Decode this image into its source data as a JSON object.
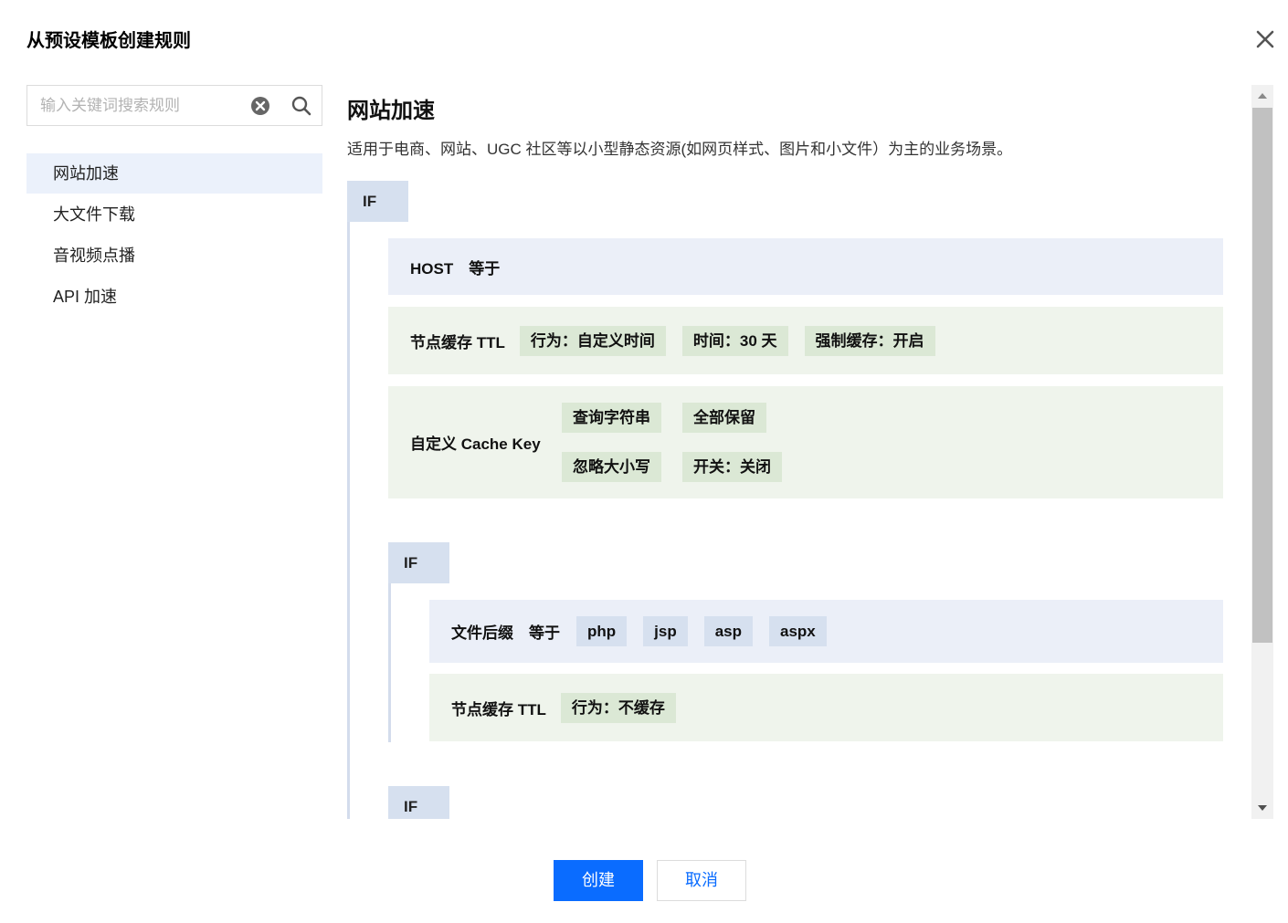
{
  "dialog": {
    "title": "从预设模板创建规则",
    "close_icon": "close-icon"
  },
  "search": {
    "placeholder": "输入关键词搜索规则",
    "value": ""
  },
  "sidebar": {
    "items": [
      {
        "label": "网站加速",
        "active": true
      },
      {
        "label": "大文件下载",
        "active": false
      },
      {
        "label": "音视频点播",
        "active": false
      },
      {
        "label": "API 加速",
        "active": false
      }
    ]
  },
  "content": {
    "title": "网站加速",
    "description": "适用于电商、网站、UGC 社区等以小型静态资源(如网页样式、图片和小文件）为主的业务场景。",
    "blocks": [
      {
        "if_label": "IF",
        "condition": {
          "label": "HOST　等于"
        },
        "actions": [
          {
            "label": "节点缓存 TTL",
            "chips": [
              "行为：自定义时间",
              "时间：30 天",
              "强制缓存：开启"
            ]
          },
          {
            "label": "自定义 Cache Key",
            "chips": [
              "查询字符串",
              "全部保留",
              "忽略大小写",
              "开关：关闭"
            ]
          }
        ]
      },
      {
        "if_label": "IF",
        "condition": {
          "label": "文件后缀　等于",
          "chips": [
            "php",
            "jsp",
            "asp",
            "aspx"
          ]
        },
        "actions": [
          {
            "label": "节点缓存 TTL",
            "chips": [
              "行为：不缓存"
            ]
          }
        ]
      },
      {
        "if_label": "IF"
      }
    ]
  },
  "footer": {
    "create_label": "创建",
    "cancel_label": "取消"
  },
  "colors": {
    "primary": "#0a6cff",
    "active_item_bg": "#ebf1fb",
    "condition_bg": "#ebeff8",
    "action_bg": "#eff4ec",
    "action_chip_bg": "#dbe8d5",
    "condition_chip_bg": "#d6e0ef"
  }
}
